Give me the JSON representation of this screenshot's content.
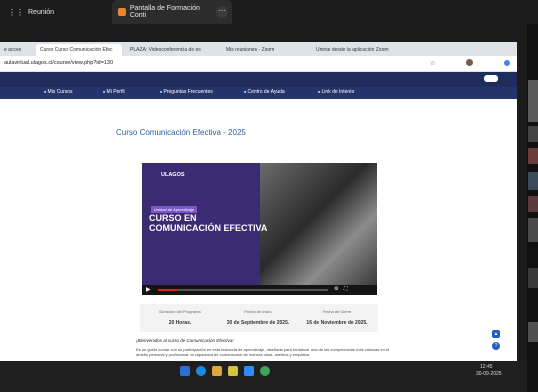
{
  "zoom": {
    "tab1": "Reunión",
    "tab2": "Pantalla de Formación Conti"
  },
  "browser": {
    "tabs": [
      "e acces",
      "Curso Curso Comunicación Efec",
      "PLAZA: Videoconferencia de es",
      "Mis reuniones - Zoom",
      "Unirse desde la aplicación Zoom"
    ],
    "url": "aulavirtual.ulagos.cl/course/view.php?id=130"
  },
  "nav": [
    "Mis Cursos",
    "Mi Perfil",
    "Preguntas Frecuentes",
    "Centro de Ayuda",
    "Link de Interés"
  ],
  "course": {
    "title": "Curso Comunicación Efectiva - 2025"
  },
  "video": {
    "logo": "ULAGOS",
    "tag": "Unidad de Aprendizaje",
    "title1": "CURSO EN",
    "title2": "COMUNICACIÓN EFECTIVA",
    "progress": 0.12
  },
  "info": {
    "headers": [
      "Duración del Programa",
      "Fecha de Inicio",
      "Fecha de Cierre"
    ],
    "values": [
      "20 Horas.",
      "30 de Septiembre de 2025.",
      "16 de Noviembre de 2025."
    ]
  },
  "welcome": "¡Bienvenidos al curso de Comunicación Efectiva!",
  "description": "Es un gusto contar con su participación en esta instancia de aprendizaje, diseñada para fortalecer una de las competencias más valiosas en el ámbito personal y profesional: la capacidad de comunicarse de manera clara, asertiva y empática.",
  "clock": {
    "time": "12:45",
    "date": "30-09-2025"
  }
}
